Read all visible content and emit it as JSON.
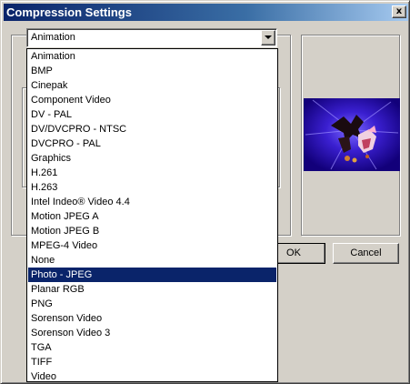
{
  "window": {
    "title": "Compression Settings",
    "close_glyph": "x"
  },
  "compressor": {
    "selected": "Animation",
    "highlighted": "Photo - JPEG",
    "options": [
      "Animation",
      "BMP",
      "Cinepak",
      "Component Video",
      "DV - PAL",
      "DV/DVCPRO - NTSC",
      "DVCPRO - PAL",
      "Graphics",
      "H.261",
      "H.263",
      "Intel Indeo® Video 4.4",
      "Motion JPEG A",
      "Motion JPEG B",
      "MPEG-4 Video",
      "None",
      "Photo - JPEG",
      "Planar RGB",
      "PNG",
      "Sorenson Video",
      "Sorenson Video 3",
      "TGA",
      "TIFF",
      "Video"
    ]
  },
  "buttons": {
    "ok": "OK",
    "cancel": "Cancel"
  },
  "colors": {
    "selection": "#0a246a",
    "dialog_face": "#d4d0c8",
    "preview_bg": "#1a0a8c"
  }
}
